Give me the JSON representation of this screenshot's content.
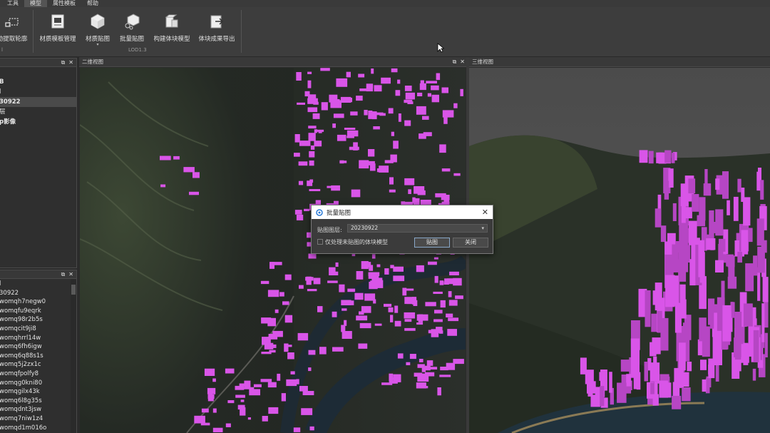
{
  "menu": {
    "items": [
      "工具",
      "模型",
      "属性模板",
      "帮助"
    ]
  },
  "ribbon": {
    "buttons": [
      {
        "label": "动提取轮廓"
      },
      {
        "label": "材质模板管理"
      },
      {
        "label": "材质贴图"
      },
      {
        "label": "批量贴图"
      },
      {
        "label": "构建体块模型"
      },
      {
        "label": "体块成果导出"
      }
    ],
    "group_label_left": "l",
    "group_label": "LOD1.3"
  },
  "left_top_panel": {
    "rows": [
      "",
      "B",
      "l",
      "30922",
      "层",
      "p影像"
    ]
  },
  "left_bottom_panel": {
    "rows": [
      "l",
      "30922",
      "womqh7negw0",
      "womqfu9eqrk",
      "womq98r2b5s",
      "womqcit9ji8",
      "womqhrrl14w",
      "womq6fh6igw",
      "womq6q88s1s",
      "womq5j2zx1c",
      "womqfpolfy8",
      "womqg0kni80",
      "womqgilx43k",
      "womq6l8g35s",
      "womqdnt3jsw",
      "womq7niw1z4",
      "womqd1m016o"
    ]
  },
  "view2d": {
    "title": "二维视图"
  },
  "view3d": {
    "title": "三维视图"
  },
  "dialog": {
    "title": "批量贴图",
    "layer_label": "贴图图层:",
    "layer_value": "20230922",
    "checkbox_label": "仅处理未贴图的体块模型",
    "apply_label": "贴图",
    "close_label": "关闭"
  },
  "colors": {
    "accent_building": "#d955e8",
    "panel_bg": "#2f2f2f",
    "ribbon_bg": "#3d3d3d"
  }
}
